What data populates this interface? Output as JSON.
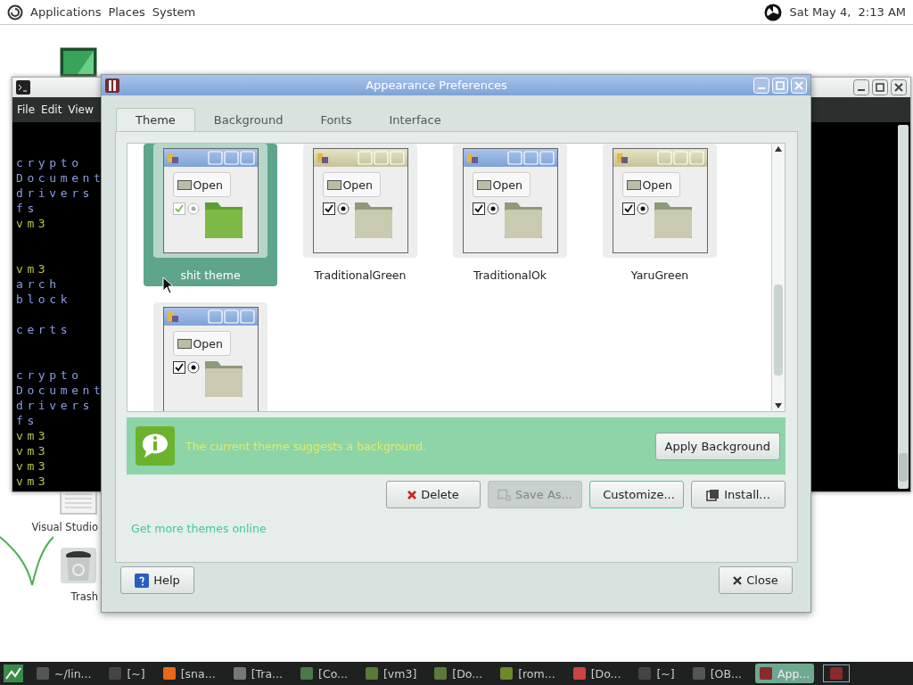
{
  "top_panel": {
    "menus": [
      "Applications",
      "Places",
      "System"
    ],
    "clock": "Sat May 4,  2:13 AM"
  },
  "desktop_icons": [
    {
      "label": "Visual Studio",
      "kind": "document"
    },
    {
      "label": "Trash",
      "kind": "trash"
    }
  ],
  "terminal": {
    "menus": [
      "File",
      "Edit",
      "View"
    ],
    "lines": [
      {
        "kind": "blank"
      },
      {
        "kind": "blank"
      },
      {
        "kind": "dir",
        "text": "crypto"
      },
      {
        "kind": "dir",
        "text": "Document"
      },
      {
        "kind": "dir",
        "text": "drivers"
      },
      {
        "kind": "dir",
        "text": "fs"
      },
      {
        "kind": "file",
        "text": "vm3"
      },
      {
        "kind": "blank"
      },
      {
        "kind": "blank"
      },
      {
        "kind": "file",
        "text": "vm3"
      },
      {
        "kind": "dir",
        "text": "arch"
      },
      {
        "kind": "dir",
        "text": "block"
      },
      {
        "kind": "blank"
      },
      {
        "kind": "dir",
        "text": "certs"
      },
      {
        "kind": "blank"
      },
      {
        "kind": "blank"
      },
      {
        "kind": "dir",
        "text": "crypto"
      },
      {
        "kind": "dir",
        "text": "Document"
      },
      {
        "kind": "dir",
        "text": "drivers"
      },
      {
        "kind": "dir",
        "text": "fs"
      },
      {
        "kind": "file",
        "text": "vm3"
      },
      {
        "kind": "file",
        "text": "vm3"
      },
      {
        "kind": "file",
        "text": "vm3"
      },
      {
        "kind": "file",
        "text": "vm3"
      }
    ]
  },
  "appearance": {
    "title": "Appearance Preferences",
    "tabs": [
      {
        "label": "Theme",
        "selected": true
      },
      {
        "label": "Background",
        "selected": false
      },
      {
        "label": "Fonts",
        "selected": false
      },
      {
        "label": "Interface",
        "selected": false
      }
    ],
    "themes": [
      {
        "name": "shit theme",
        "selected": true,
        "kind": "vivid",
        "open_label": "Open"
      },
      {
        "name": "TraditionalGreen",
        "selected": false,
        "kind": "khaki",
        "open_label": "Open"
      },
      {
        "name": "TraditionalOk",
        "selected": false,
        "kind": "blue",
        "open_label": "Open"
      },
      {
        "name": "YaruGreen",
        "selected": false,
        "kind": "khaki",
        "open_label": "Open"
      },
      {
        "selected": false,
        "kind": "blue",
        "open_label": "Open"
      }
    ],
    "info": {
      "message": "The current theme suggests a background.",
      "button": "Apply Background"
    },
    "actions": [
      {
        "label": "Delete",
        "kind": "delete",
        "disabled": false,
        "focused": false
      },
      {
        "label": "Save As...",
        "kind": "save",
        "disabled": true,
        "focused": false
      },
      {
        "label": "Customize...",
        "kind": "customize",
        "disabled": false,
        "focused": true
      },
      {
        "label": "Install...",
        "kind": "install",
        "disabled": false,
        "focused": false
      }
    ],
    "link": "Get more themes online",
    "help": "Help",
    "close": "Close"
  },
  "taskbar": {
    "items": [
      {
        "label": "~/lin...",
        "selected": false
      },
      {
        "label": "[~]",
        "selected": false
      },
      {
        "label": "[sna...",
        "selected": false
      },
      {
        "label": "[Tra...",
        "selected": false
      },
      {
        "label": "[Co...",
        "selected": false
      },
      {
        "label": "[vm3]",
        "selected": false
      },
      {
        "label": "[Do...",
        "selected": false
      },
      {
        "label": "[rom...",
        "selected": false
      },
      {
        "label": "[Do...",
        "selected": false
      },
      {
        "label": "[~]",
        "selected": false
      },
      {
        "label": "[OB...",
        "selected": false
      },
      {
        "label": "App...",
        "selected": true
      }
    ]
  }
}
